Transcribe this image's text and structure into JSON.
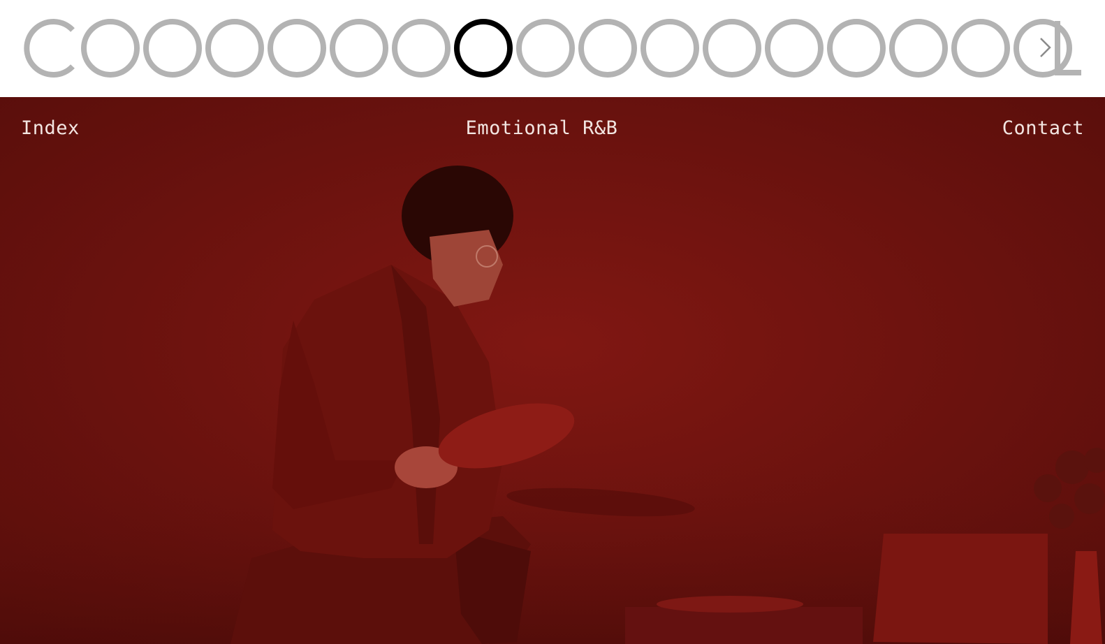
{
  "header": {
    "logo_text": "COOOOOOOOOOOOOOOOCL",
    "active_circle_index": 7,
    "circle_count": 16,
    "colors": {
      "inactive": "#b3b3b3",
      "active": "#000000"
    },
    "next_icon": "chevron-right-icon"
  },
  "nav": {
    "index_label": "Index",
    "title": "Emotional R&B",
    "contact_label": "Contact"
  },
  "hero": {
    "background_color": "#741410",
    "image_description_icon": "video-still"
  }
}
